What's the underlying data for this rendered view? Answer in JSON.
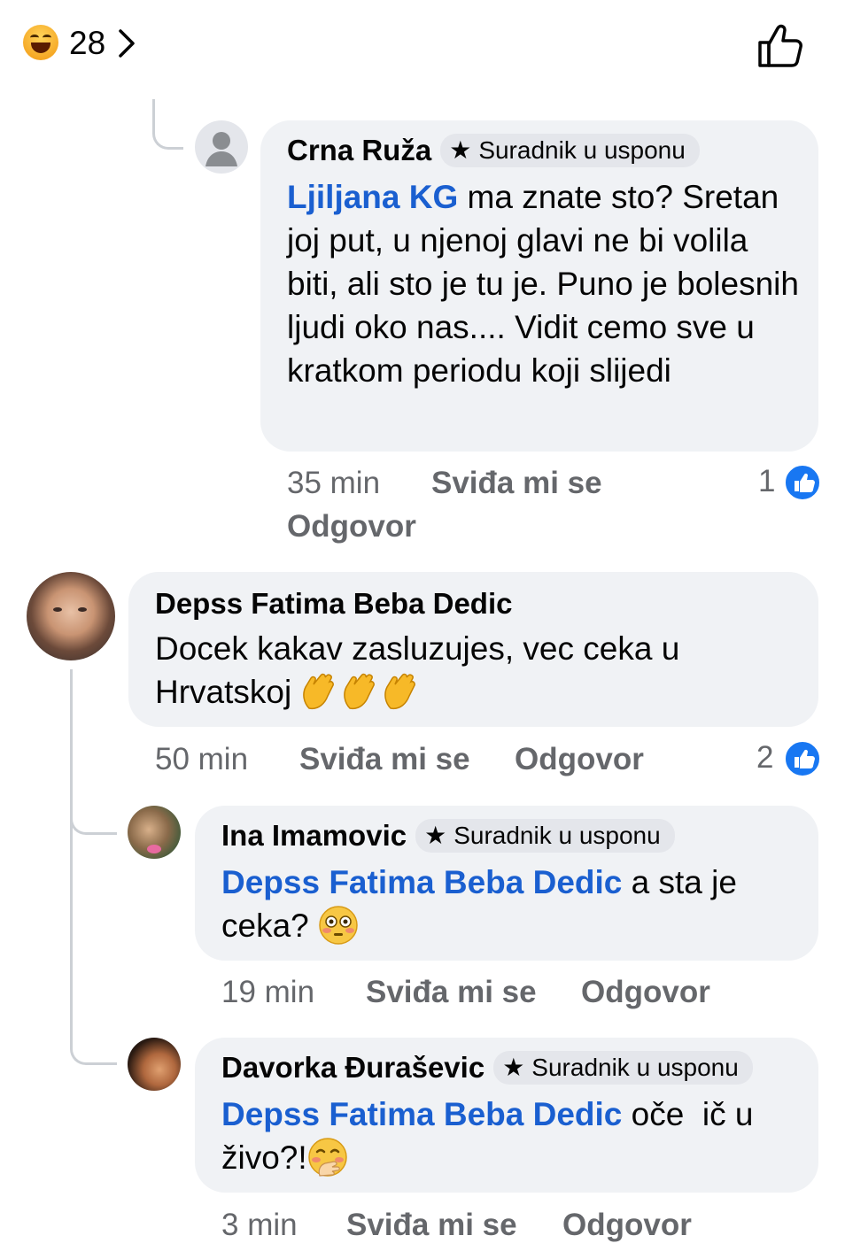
{
  "reactions": {
    "emoji_icon": "laughing-face-icon",
    "count": "28"
  },
  "colors": {
    "mention": "#1a5fd0",
    "bubble": "#f0f2f5",
    "meta": "#65676b",
    "like": "#1877f2"
  },
  "comments": [
    {
      "author": "Crna Ruža",
      "badge": "Suradnik u usponu",
      "mention": "Ljiljana KG",
      "text": " ma znate sto? Sretan joj put, u njenoj glavi ne bi volila biti, ali sto je tu je. Puno je bolesnih ljudi oko nas.... Vidit cemo sve u kratkom periodu koji slijedi",
      "time": "35 min",
      "like_label": "Sviđa mi se",
      "reply_label": "Odgovor",
      "likes": "1"
    },
    {
      "author": "Depss Fatima Beba Dedic",
      "text_line1": "Docek kakav zasluzujes, vec ceka u",
      "text_line2": "Hrvatskoj ",
      "emoji": "clapping-hands-icon",
      "time": "50 min",
      "like_label": "Sviđa mi se",
      "reply_label": "Odgovor",
      "likes": "2"
    },
    {
      "author": "Ina Imamovic",
      "badge": "Suradnik u usponu",
      "mention": "Depss Fatima Beba Dedic",
      "text_line1": " a sta je",
      "text_line2": "ceka? ",
      "emoji": "flushed-face-icon",
      "time": "19 min",
      "like_label": "Sviđa mi se",
      "reply_label": "Odgovor"
    },
    {
      "author": "Davorka Đuraševic",
      "badge": "Suradnik u usponu",
      "mention": "Depss Fatima Beba Dedic",
      "text_line1": " oče  ič u",
      "text_line2": "živo?!",
      "emoji": "hand-over-mouth-face-icon",
      "time": "3 min",
      "like_label": "Sviđa mi se",
      "reply_label": "Odgovor"
    }
  ]
}
